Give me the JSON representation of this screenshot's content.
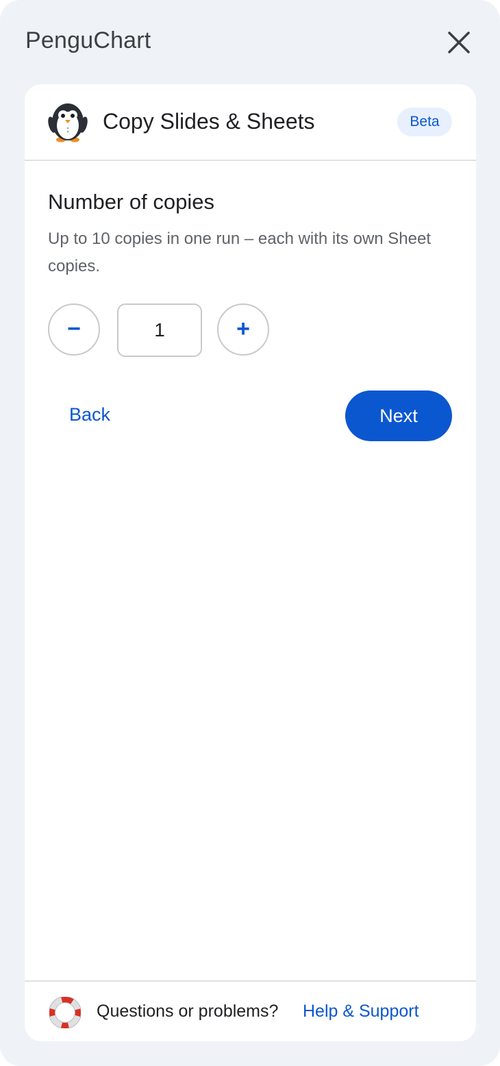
{
  "app": {
    "title": "PenguChart",
    "close_icon": "close-icon"
  },
  "card": {
    "title": "Copy Slides & Sheets",
    "badge": "Beta",
    "logo_icon": "penguin-icon"
  },
  "copies": {
    "heading": "Number of copies",
    "description": "Up to 10 copies in one run – each with its own Sheet copies.",
    "value": "1",
    "minus_label": "−",
    "plus_label": "+"
  },
  "actions": {
    "back_label": "Back",
    "next_label": "Next"
  },
  "footer": {
    "question_text": "Questions or problems?",
    "help_label": "Help & Support",
    "help_icon": "lifebuoy-icon"
  },
  "colors": {
    "accent": "#0b57d0",
    "panel_bg": "#eff2f7",
    "badge_bg": "#e8f0fe"
  }
}
